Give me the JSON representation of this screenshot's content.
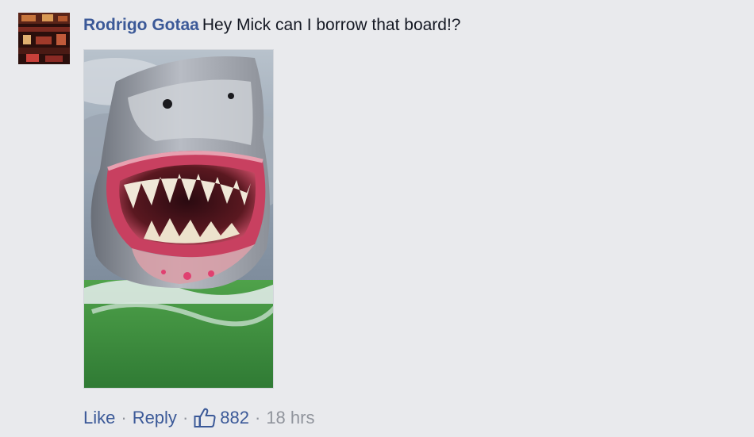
{
  "comment": {
    "author": "Rodrigo Gotaa",
    "text": "Hey Mick can I borrow that board!?",
    "avatar": "profile-photo",
    "photo": "shark-image"
  },
  "actions": {
    "like_label": "Like",
    "reply_label": "Reply",
    "separator": "·",
    "like_count": "882",
    "timestamp": "18 hrs",
    "like_icon": "thumbs-up-icon"
  },
  "colors": {
    "link": "#3b5998",
    "meta": "#90949c",
    "background": "#e9eaed",
    "text": "#141823"
  }
}
